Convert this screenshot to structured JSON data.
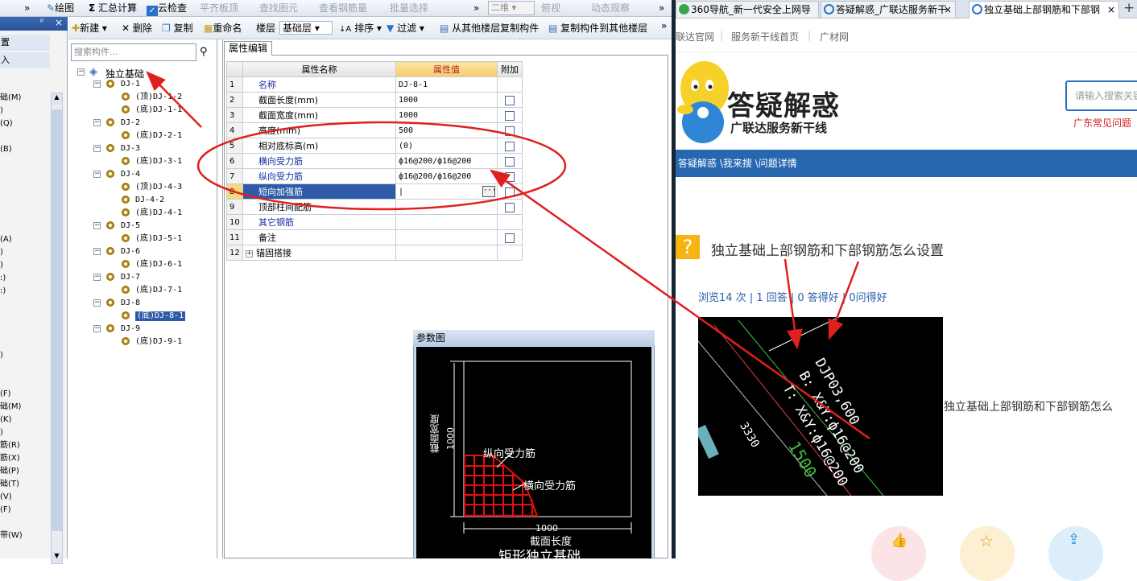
{
  "toolbar": {
    "items": [
      {
        "label": "»",
        "disabled": false
      },
      {
        "label": "绘图",
        "disabled": false
      },
      {
        "label": "汇总计算",
        "disabled": false
      },
      {
        "label": "云检查",
        "disabled": false
      },
      {
        "label": "平齐板顶",
        "disabled": true
      },
      {
        "label": "查找图元",
        "disabled": true
      },
      {
        "label": "查看钢筋量",
        "disabled": true
      },
      {
        "label": "批量选择",
        "disabled": true
      },
      {
        "label": "»",
        "disabled": false
      },
      {
        "label": "俯视",
        "disabled": true
      },
      {
        "label": "动态观察",
        "disabled": true
      }
    ],
    "view_select": "二维",
    "sigma": "Σ"
  },
  "left_panel": {
    "pin": "ᵖ",
    "close": "×",
    "row1": "置",
    "row2": "入",
    "items": [
      "础(M)",
      ")",
      "(Q)",
      "(B)",
      "(A)",
      ")",
      ")",
      ":)",
      ":)",
      ")",
      "(F)",
      "础(M)",
      "(K)",
      ")",
      "筋(R)",
      "筋(X)",
      "础(P)",
      "础(T)",
      "(V)",
      "(F)",
      "带(W)"
    ]
  },
  "tree_toolbar": {
    "new": "新建",
    "delete": "删除",
    "copy": "复制",
    "rename": "重命名",
    "floor_label": "楼层",
    "floor_value": "基础层",
    "sort": "排序",
    "filter": "过滤",
    "copy_from": "从其他楼层复制构件",
    "copy_to": "复制构件到其他楼层",
    "more": "»"
  },
  "search": {
    "placeholder": "搜索构件..."
  },
  "tree": {
    "root": "独立基础",
    "nodes": [
      {
        "name": "DJ-1",
        "children": [
          "(顶)DJ-1-2",
          "(底)DJ-1-1"
        ]
      },
      {
        "name": "DJ-2",
        "children": [
          "(底)DJ-2-1"
        ]
      },
      {
        "name": "DJ-3",
        "children": [
          "(底)DJ-3-1"
        ]
      },
      {
        "name": "DJ-4",
        "children": [
          "(顶)DJ-4-3",
          "DJ-4-2",
          "(底)DJ-4-1"
        ]
      },
      {
        "name": "DJ-5",
        "children": [
          "(底)DJ-5-1"
        ]
      },
      {
        "name": "DJ-6",
        "children": [
          "(底)DJ-6-1"
        ]
      },
      {
        "name": "DJ-7",
        "children": [
          "(底)DJ-7-1"
        ]
      },
      {
        "name": "DJ-8",
        "children": [
          "(底)DJ-8-1"
        ]
      },
      {
        "name": "DJ-9",
        "children": [
          "(底)DJ-9-1"
        ]
      }
    ],
    "selected": "(底)DJ-8-1"
  },
  "prop": {
    "tab": "属性编辑",
    "col_name": "属性名称",
    "col_value": "属性值",
    "col_add": "附加",
    "rows": [
      {
        "n": "1",
        "name": "名称",
        "value": "DJ-8-1",
        "blue": true,
        "cb": false
      },
      {
        "n": "2",
        "name": "截面长度(mm)",
        "value": "1000",
        "blue": false,
        "cb": true
      },
      {
        "n": "3",
        "name": "截面宽度(mm)",
        "value": "1000",
        "blue": false,
        "cb": true
      },
      {
        "n": "4",
        "name": "高度(mm)",
        "value": "500",
        "blue": false,
        "cb": true
      },
      {
        "n": "5",
        "name": "相对底标高(m)",
        "value": "(0)",
        "blue": false,
        "cb": true
      },
      {
        "n": "6",
        "name": "横向受力筋",
        "value": "ф16@200/ф16@200",
        "blue": true,
        "cb": true
      },
      {
        "n": "7",
        "name": "纵向受力筋",
        "value": "ф16@200/ф16@200",
        "blue": true,
        "cb": true
      },
      {
        "n": "8",
        "name": "短向加强筋",
        "value": "",
        "blue": false,
        "cb": true,
        "selected": true
      },
      {
        "n": "9",
        "name": "顶部柱间配筋",
        "value": "",
        "blue": false,
        "cb": true
      },
      {
        "n": "10",
        "name": "其它钢筋",
        "value": "",
        "blue": true,
        "cb": false
      },
      {
        "n": "11",
        "name": "备注",
        "value": "",
        "blue": false,
        "cb": true
      },
      {
        "n": "12",
        "name": "锚固搭接",
        "value": "",
        "blue": false,
        "cb": false,
        "expand": true
      }
    ]
  },
  "param": {
    "title": "参数图",
    "width_label": "截面宽度",
    "width_value": "1000",
    "length_label": "截面长度",
    "length_value": "1000",
    "long_bar": "纵向受力筋",
    "trans_bar": "横向受力筋",
    "caption": "矩形独立基础"
  },
  "browser": {
    "tabs": [
      "360导航_新一代安全上网导",
      "答疑解惑_广联达服务新干",
      "独立基础上部钢筋和下部钢"
    ],
    "new_tab": "+",
    "close": "×",
    "nav": [
      "联达官网",
      "服务新干线首页",
      "广材网"
    ],
    "logo_title": "答疑解惑",
    "logo_sub": "广联达服务新干线",
    "search_placeholder": "请输入搜索关键",
    "hot_link": "广东常见问题",
    "breadcrumb": "答疑解惑 \\我来搜 \\问题详情",
    "question": "独立基础上部钢筋和下部钢筋怎么设置",
    "stats": "浏览14 次 | 1 回答 | 0 答得好 | 0问得好",
    "side_text": "独立基础上部钢筋和下部钢筋怎么",
    "cad_lines": [
      "DJP03,600",
      "B: X&Y:ф16@200",
      "T: X&Y:ф16@200",
      "3330",
      "1500"
    ]
  },
  "colors": {
    "accent": "#2667b0",
    "annotation": "#e0201e",
    "question": "#f5b412"
  }
}
